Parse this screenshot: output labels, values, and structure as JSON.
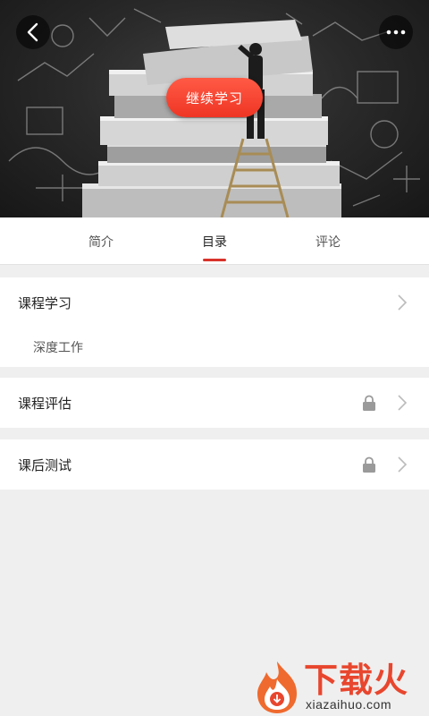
{
  "hero": {
    "cta_label": "继续学习",
    "back_icon": "chevron-left-icon",
    "more_icon": "more-dots-icon"
  },
  "tabs": [
    {
      "label": "简介",
      "active": false
    },
    {
      "label": "目录",
      "active": true
    },
    {
      "label": "评论",
      "active": false
    }
  ],
  "sections": [
    {
      "title": "课程学习",
      "locked": false,
      "items": [
        {
          "label": "深度工作"
        }
      ]
    },
    {
      "title": "课程评估",
      "locked": true,
      "items": []
    },
    {
      "title": "课后测试",
      "locked": true,
      "items": []
    }
  ],
  "watermark": {
    "title": "下载火",
    "url": "xiazaihuo.com"
  },
  "colors": {
    "accent": "#d8322a",
    "cta": "#ef3524",
    "page_bg": "#efefef"
  }
}
